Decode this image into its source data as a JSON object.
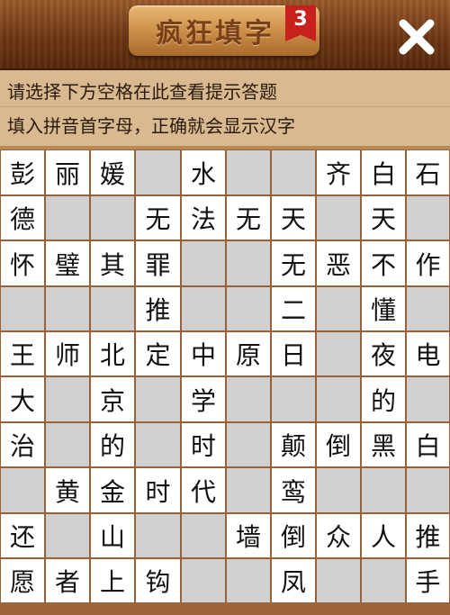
{
  "header": {
    "title": "疯狂填字",
    "level": "3",
    "close_icon": "close-icon"
  },
  "hint": {
    "line1": "请选择下方空格在此查看提示答题",
    "line2": "填入拼音首字母，正确就会显示汉字"
  },
  "grid": {
    "rows": [
      [
        "彭",
        "丽",
        "媛",
        "",
        "水",
        "",
        "",
        "齐",
        "白",
        "石"
      ],
      [
        "德",
        "",
        "",
        "无",
        "法",
        "无",
        "天",
        "",
        "天",
        ""
      ],
      [
        "怀",
        "璧",
        "其",
        "罪",
        "",
        "",
        "无",
        "恶",
        "不",
        "作"
      ],
      [
        "",
        "",
        "",
        "推",
        "",
        "",
        "二",
        "",
        "懂",
        ""
      ],
      [
        "王",
        "师",
        "北",
        "定",
        "中",
        "原",
        "日",
        "",
        "夜",
        "电"
      ],
      [
        "大",
        "",
        "京",
        "",
        "学",
        "",
        "",
        "",
        "的",
        ""
      ],
      [
        "治",
        "",
        "的",
        "",
        "时",
        "",
        "颠",
        "倒",
        "黑",
        "白"
      ],
      [
        "",
        "黄",
        "金",
        "时",
        "代",
        "",
        "鸾",
        "",
        "",
        ""
      ],
      [
        "还",
        "",
        "山",
        "",
        "",
        "墙",
        "倒",
        "众",
        "人",
        "推"
      ],
      [
        "愿",
        "者",
        "上",
        "钩",
        "",
        "",
        "凤",
        "",
        "",
        "手"
      ]
    ]
  },
  "colors": {
    "header_brown": "#6a3512",
    "hint_bg": "#d9b98f",
    "cell_white": "#ffffff",
    "cell_gray": "#d0d0d0",
    "badge_red": "#c8201c"
  }
}
